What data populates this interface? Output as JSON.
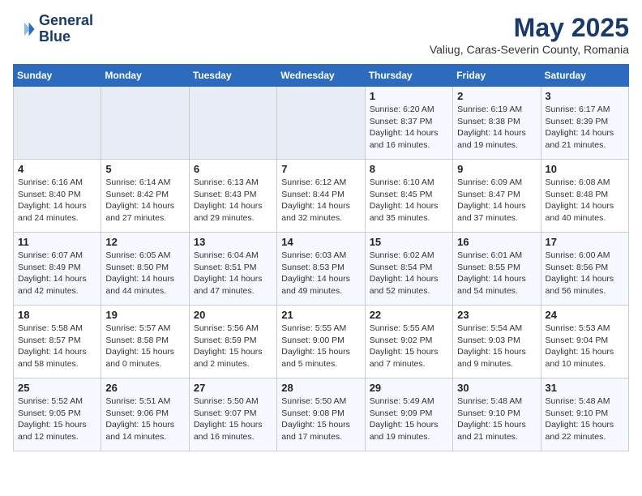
{
  "header": {
    "logo_line1": "General",
    "logo_line2": "Blue",
    "month": "May 2025",
    "location": "Valiug, Caras-Severin County, Romania"
  },
  "weekdays": [
    "Sunday",
    "Monday",
    "Tuesday",
    "Wednesday",
    "Thursday",
    "Friday",
    "Saturday"
  ],
  "weeks": [
    [
      {
        "day": "",
        "info": ""
      },
      {
        "day": "",
        "info": ""
      },
      {
        "day": "",
        "info": ""
      },
      {
        "day": "",
        "info": ""
      },
      {
        "day": "1",
        "info": "Sunrise: 6:20 AM\nSunset: 8:37 PM\nDaylight: 14 hours\nand 16 minutes."
      },
      {
        "day": "2",
        "info": "Sunrise: 6:19 AM\nSunset: 8:38 PM\nDaylight: 14 hours\nand 19 minutes."
      },
      {
        "day": "3",
        "info": "Sunrise: 6:17 AM\nSunset: 8:39 PM\nDaylight: 14 hours\nand 21 minutes."
      }
    ],
    [
      {
        "day": "4",
        "info": "Sunrise: 6:16 AM\nSunset: 8:40 PM\nDaylight: 14 hours\nand 24 minutes."
      },
      {
        "day": "5",
        "info": "Sunrise: 6:14 AM\nSunset: 8:42 PM\nDaylight: 14 hours\nand 27 minutes."
      },
      {
        "day": "6",
        "info": "Sunrise: 6:13 AM\nSunset: 8:43 PM\nDaylight: 14 hours\nand 29 minutes."
      },
      {
        "day": "7",
        "info": "Sunrise: 6:12 AM\nSunset: 8:44 PM\nDaylight: 14 hours\nand 32 minutes."
      },
      {
        "day": "8",
        "info": "Sunrise: 6:10 AM\nSunset: 8:45 PM\nDaylight: 14 hours\nand 35 minutes."
      },
      {
        "day": "9",
        "info": "Sunrise: 6:09 AM\nSunset: 8:47 PM\nDaylight: 14 hours\nand 37 minutes."
      },
      {
        "day": "10",
        "info": "Sunrise: 6:08 AM\nSunset: 8:48 PM\nDaylight: 14 hours\nand 40 minutes."
      }
    ],
    [
      {
        "day": "11",
        "info": "Sunrise: 6:07 AM\nSunset: 8:49 PM\nDaylight: 14 hours\nand 42 minutes."
      },
      {
        "day": "12",
        "info": "Sunrise: 6:05 AM\nSunset: 8:50 PM\nDaylight: 14 hours\nand 44 minutes."
      },
      {
        "day": "13",
        "info": "Sunrise: 6:04 AM\nSunset: 8:51 PM\nDaylight: 14 hours\nand 47 minutes."
      },
      {
        "day": "14",
        "info": "Sunrise: 6:03 AM\nSunset: 8:53 PM\nDaylight: 14 hours\nand 49 minutes."
      },
      {
        "day": "15",
        "info": "Sunrise: 6:02 AM\nSunset: 8:54 PM\nDaylight: 14 hours\nand 52 minutes."
      },
      {
        "day": "16",
        "info": "Sunrise: 6:01 AM\nSunset: 8:55 PM\nDaylight: 14 hours\nand 54 minutes."
      },
      {
        "day": "17",
        "info": "Sunrise: 6:00 AM\nSunset: 8:56 PM\nDaylight: 14 hours\nand 56 minutes."
      }
    ],
    [
      {
        "day": "18",
        "info": "Sunrise: 5:58 AM\nSunset: 8:57 PM\nDaylight: 14 hours\nand 58 minutes."
      },
      {
        "day": "19",
        "info": "Sunrise: 5:57 AM\nSunset: 8:58 PM\nDaylight: 15 hours\nand 0 minutes."
      },
      {
        "day": "20",
        "info": "Sunrise: 5:56 AM\nSunset: 8:59 PM\nDaylight: 15 hours\nand 2 minutes."
      },
      {
        "day": "21",
        "info": "Sunrise: 5:55 AM\nSunset: 9:00 PM\nDaylight: 15 hours\nand 5 minutes."
      },
      {
        "day": "22",
        "info": "Sunrise: 5:55 AM\nSunset: 9:02 PM\nDaylight: 15 hours\nand 7 minutes."
      },
      {
        "day": "23",
        "info": "Sunrise: 5:54 AM\nSunset: 9:03 PM\nDaylight: 15 hours\nand 9 minutes."
      },
      {
        "day": "24",
        "info": "Sunrise: 5:53 AM\nSunset: 9:04 PM\nDaylight: 15 hours\nand 10 minutes."
      }
    ],
    [
      {
        "day": "25",
        "info": "Sunrise: 5:52 AM\nSunset: 9:05 PM\nDaylight: 15 hours\nand 12 minutes."
      },
      {
        "day": "26",
        "info": "Sunrise: 5:51 AM\nSunset: 9:06 PM\nDaylight: 15 hours\nand 14 minutes."
      },
      {
        "day": "27",
        "info": "Sunrise: 5:50 AM\nSunset: 9:07 PM\nDaylight: 15 hours\nand 16 minutes."
      },
      {
        "day": "28",
        "info": "Sunrise: 5:50 AM\nSunset: 9:08 PM\nDaylight: 15 hours\nand 17 minutes."
      },
      {
        "day": "29",
        "info": "Sunrise: 5:49 AM\nSunset: 9:09 PM\nDaylight: 15 hours\nand 19 minutes."
      },
      {
        "day": "30",
        "info": "Sunrise: 5:48 AM\nSunset: 9:10 PM\nDaylight: 15 hours\nand 21 minutes."
      },
      {
        "day": "31",
        "info": "Sunrise: 5:48 AM\nSunset: 9:10 PM\nDaylight: 15 hours\nand 22 minutes."
      }
    ]
  ]
}
